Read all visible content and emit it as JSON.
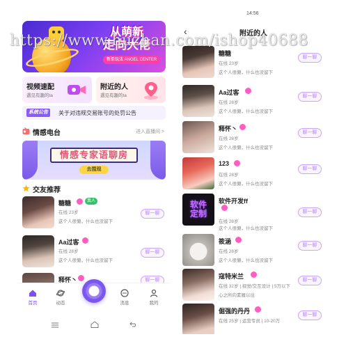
{
  "watermark": "https://www.huzhan.com/ishop40688",
  "left": {
    "banner": {
      "headline_1": "从萌新",
      "headline_2": "走向大佬",
      "tag": "新单玩法 ANGEL CENTER"
    },
    "quick": [
      {
        "title": "视频速配",
        "sub": "遇见有趣的ta"
      },
      {
        "title": "附近的人",
        "sub": "遇见有趣的ta"
      }
    ],
    "notice": {
      "badge": "系统公告",
      "text": "关于对违规交易账号的处罚公告"
    },
    "radio": {
      "title": "情感电台",
      "more": "进入直播间 >",
      "board": "情感专家语聊房",
      "go": "去围观"
    },
    "recommend": {
      "title": "交友推荐",
      "items": [
        {
          "name": "糖糖",
          "real": "真人",
          "meta": "在线  23岁",
          "sig": "这个人很懒，什么也没留下",
          "btn": "聊一聊"
        },
        {
          "name": "Aa过客",
          "meta": "在线  28岁",
          "sig": "这个人很懒，什么也没留下",
          "btn": "聊一聊"
        },
        {
          "name": "释怀丶",
          "btn": "聊一聊"
        }
      ]
    },
    "tabs": [
      {
        "label": "首页"
      },
      {
        "label": "动态"
      },
      {
        "label": "消息"
      },
      {
        "label": "我的"
      }
    ]
  },
  "right": {
    "status_time": "14:56",
    "title": "附近的人",
    "items": [
      {
        "name": "糖糖",
        "meta": "在线  23岁",
        "sig": "这个人很懒，什么也没留下",
        "btn": "聊一聊"
      },
      {
        "name": "Aa过客",
        "meta": "在线  28岁",
        "sig": "这个人很懒，什么也没留下",
        "btn": "聊一聊"
      },
      {
        "name": "释怀丶",
        "meta": "在线  28岁",
        "sig": "这个人很懒，什么也没留下",
        "btn": "聊一聊"
      },
      {
        "name": "123",
        "meta": "在线  28岁",
        "sig": "这个人很懒，什么也没留下",
        "btn": "聊一聊"
      },
      {
        "name": "软件开发ff",
        "photo_text": "软件定制",
        "meta": "在线  28岁",
        "sig": "这个人很懒，什么也没留下",
        "btn": "聊一聊"
      },
      {
        "name": "筱涵",
        "meta": "在线  28岁",
        "sig": "这个人很懒，什么也没留下",
        "btn": "聊一聊"
      },
      {
        "name": "寇特米兰",
        "meta": "在线  32岁 | 视觉/交互设计 | 5万以下",
        "sig": "心之所向素履以往",
        "btn": "聊一聊"
      },
      {
        "name": "倔强的丹丹",
        "meta": "在线  25岁 | 运营专员 | 10-20万",
        "btn": "聊一聊"
      }
    ]
  },
  "colors": {
    "accent": "#7d52f0",
    "female": "#ff5ec0",
    "real_badge": "#35c06a"
  }
}
